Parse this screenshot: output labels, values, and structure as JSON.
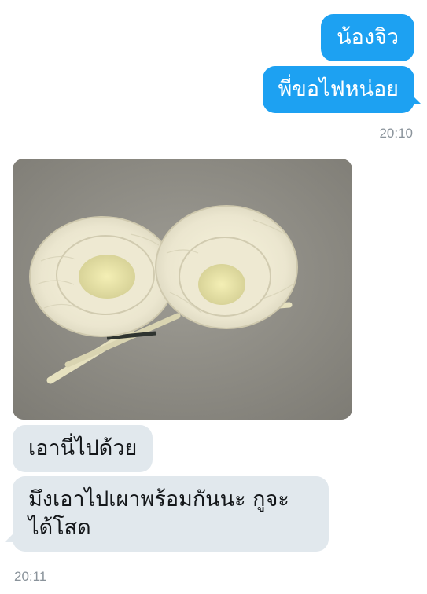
{
  "conversation": {
    "outgoing": [
      {
        "text": "น้องจิว"
      },
      {
        "text": "พี่ขอไฟหน่อย"
      }
    ],
    "outgoing_time": "20:10",
    "incoming_photo": {
      "description_icon": "photo-flowers"
    },
    "incoming": [
      {
        "text": "เอานี่ไปด้วย"
      },
      {
        "line1": "มึงเอาไปเผาพร้อมกันนะ กูจะ",
        "line2": "ได้โสด"
      }
    ],
    "incoming_time": "20:11"
  },
  "colors": {
    "outgoing_bubble": "#1da1f2",
    "incoming_bubble": "#e1e8ed",
    "timestamp": "#8a939b"
  }
}
